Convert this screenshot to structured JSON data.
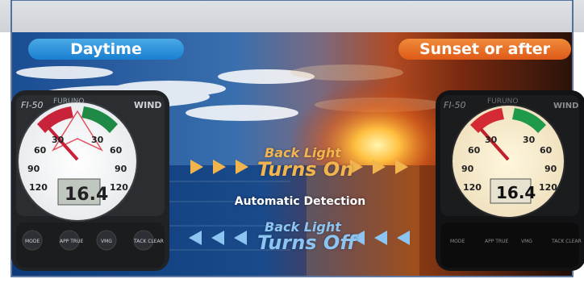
{
  "labels": {
    "daytime": "Daytime",
    "sunset": "Sunset or after",
    "backlight_on_small": "Back Light",
    "backlight_on_big": "Turns On",
    "automatic": "Automatic Detection",
    "backlight_off_small": "Back Light",
    "backlight_off_big": "Turns Off"
  },
  "display": {
    "reading": "16.4",
    "model": "FI-50",
    "mode": "WIND",
    "brand": "FURUNO",
    "scale_labels": [
      "30",
      "60",
      "90",
      "120"
    ],
    "buttons": [
      "MODE",
      "APP TRUE",
      "VMG",
      "TACK CLEAR"
    ]
  },
  "colors": {
    "day_pill": "#1a7fd0",
    "sunset_pill": "#de5a18",
    "arrow_on": "#f2b54e",
    "arrow_off": "#8cc4f2"
  }
}
